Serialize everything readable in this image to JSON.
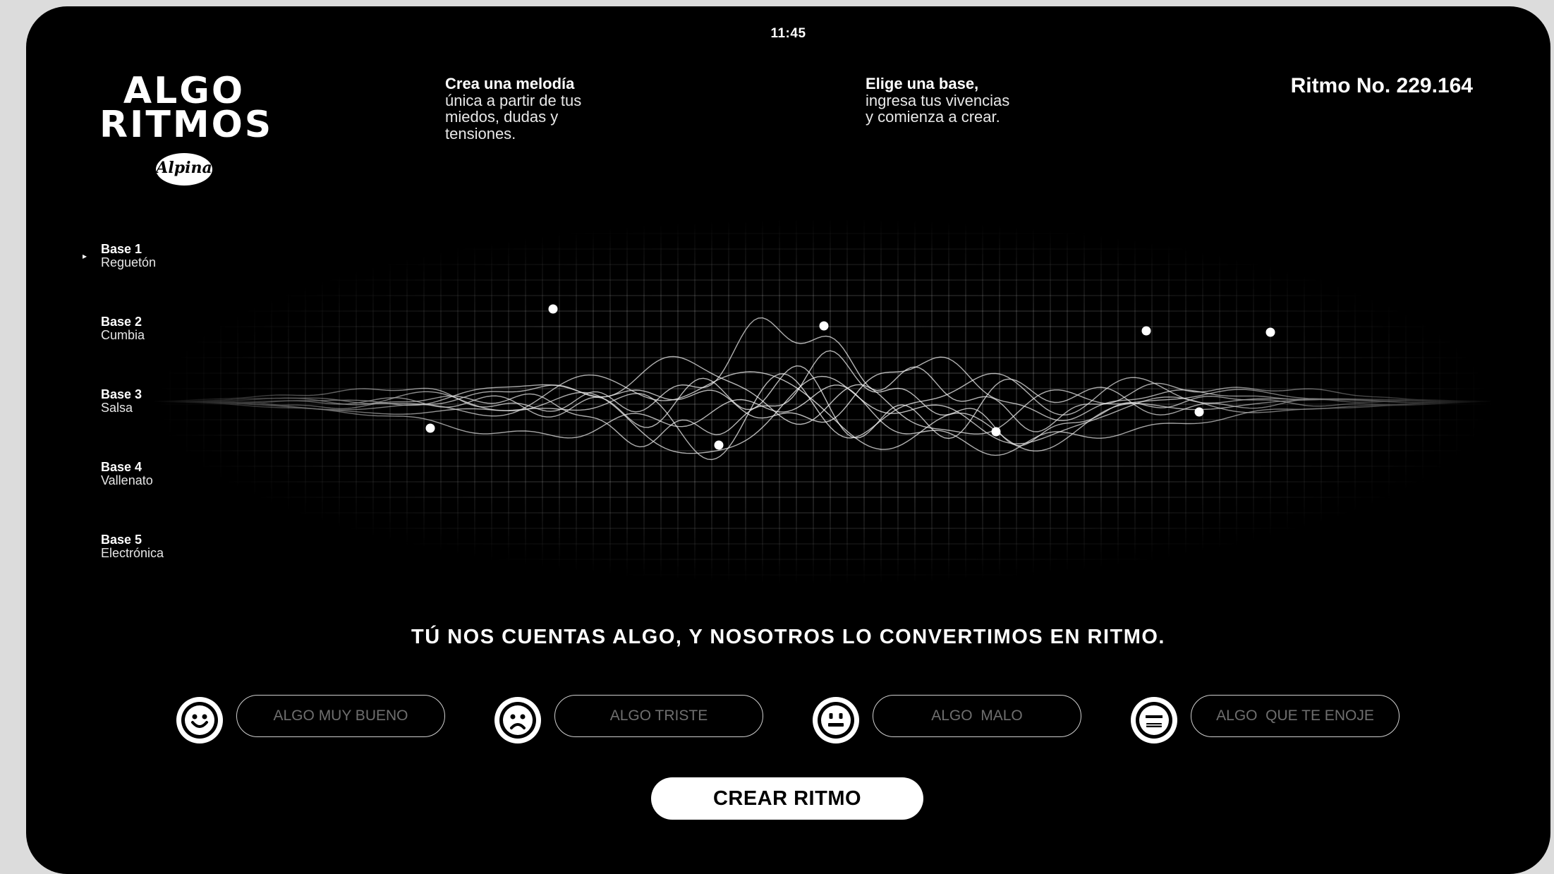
{
  "status_bar": {
    "time": "11:45"
  },
  "logo": {
    "line1": "ALGO",
    "line2": "RITMOS",
    "brand": "Alpina"
  },
  "intro": {
    "left": {
      "lead": "Crea una melodía",
      "rest": "única a partir de tus\nmiedos, dudas y\ntensiones."
    },
    "right": {
      "lead": "Elige una base,",
      "rest": "ingresa tus vivencias\ny comienza a crear."
    }
  },
  "rhythm_number": "Ritmo No. 229.164",
  "bases": {
    "selected_marker": "▸",
    "items": [
      {
        "title": "Base 1",
        "genre": "Reguetón",
        "selected": true
      },
      {
        "title": "Base 2",
        "genre": "Cumbia",
        "selected": false
      },
      {
        "title": "Base 3",
        "genre": "Salsa",
        "selected": false
      },
      {
        "title": "Base 4",
        "genre": "Vallenato",
        "selected": false
      },
      {
        "title": "Base 5",
        "genre": "Electrónica",
        "selected": false
      }
    ]
  },
  "visualization": {
    "colors": {
      "lines": "#ffffff",
      "grid": "#ffffff"
    }
  },
  "tagline": "TÚ NOS CUENTAS ALGO, Y NOSOTROS LO CONVERTIMOS EN RITMO.",
  "moods": [
    {
      "icon": "smiley-happy-icon",
      "placeholder": "ALGO MUY BUENO"
    },
    {
      "icon": "smiley-sad-icon",
      "placeholder": "ALGO TRISTE"
    },
    {
      "icon": "smiley-neutral-icon",
      "placeholder": "ALGO  MALO"
    },
    {
      "icon": "smiley-angry-icon",
      "placeholder": "ALGO  QUE TE ENOJE"
    }
  ],
  "create_button": "CREAR RITMO"
}
